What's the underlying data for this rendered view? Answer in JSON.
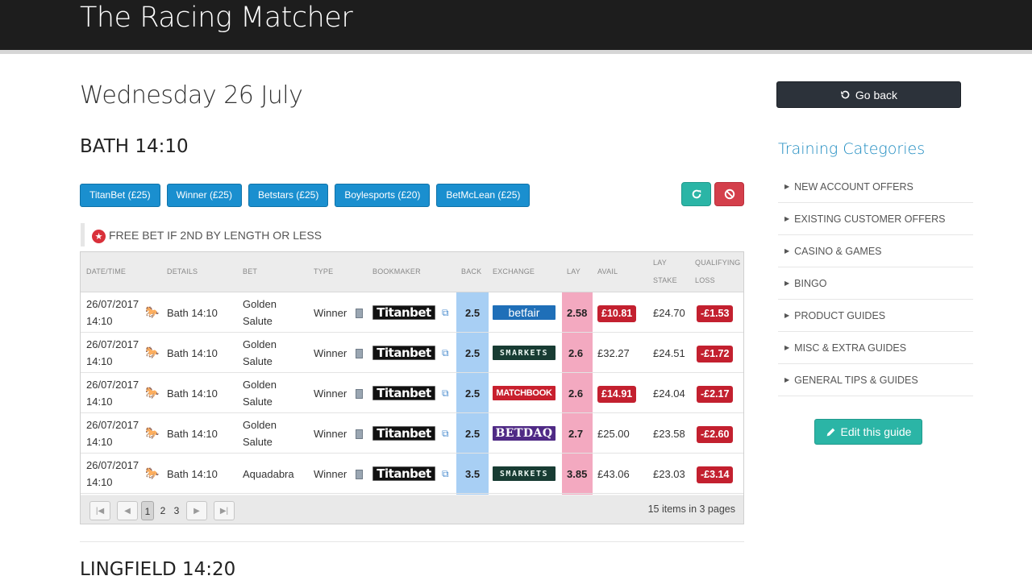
{
  "app": {
    "brand": "The Racing Matcher"
  },
  "page": {
    "date_title": "Wednesday 26 July",
    "race_title": "BATH 14:10",
    "next_race_title": "LINGFIELD 14:20"
  },
  "bookmaker_buttons": [
    "TitanBet (£25)",
    "Winner (£25)",
    "Betstars (£25)",
    "Boylesports (£20)",
    "BetMcLean (£25)"
  ],
  "action_icons": {
    "refresh": "refresh-icon",
    "cancel": "ban-icon"
  },
  "promo": {
    "icon": "star-icon",
    "text": "FREE BET IF 2ND BY LENGTH OR LESS"
  },
  "table": {
    "headers": {
      "datetime": "DATE/TIME",
      "details": "DETAILS",
      "bet": "BET",
      "type": "TYPE",
      "bookmaker": "BOOKMAKER",
      "back": "BACK",
      "exchange": "EXCHANGE",
      "lay": "LAY",
      "avail": "AVAIL",
      "lay_stake_1": "LAY",
      "lay_stake_2": "STAKE",
      "qualifying_1": "QUALIFYING",
      "qualifying_2": "LOSS"
    },
    "rows": [
      {
        "date": "26/07/2017",
        "time": "14:10",
        "details": "Bath 14:10",
        "bet_1": "Golden",
        "bet_2": "Salute",
        "type": "Winner",
        "bookmaker": "Titanbet",
        "back": "2.5",
        "exchange": "betfair",
        "lay": "2.58",
        "avail": "£10.81",
        "lay_stake": "£24.70",
        "qualifying_loss": "-£1.53"
      },
      {
        "date": "26/07/2017",
        "time": "14:10",
        "details": "Bath 14:10",
        "bet_1": "Golden",
        "bet_2": "Salute",
        "type": "Winner",
        "bookmaker": "Titanbet",
        "back": "2.5",
        "exchange": "SMARKETS",
        "lay": "2.6",
        "avail": "£32.27",
        "lay_stake": "£24.51",
        "qualifying_loss": "-£1.72"
      },
      {
        "date": "26/07/2017",
        "time": "14:10",
        "details": "Bath 14:10",
        "bet_1": "Golden",
        "bet_2": "Salute",
        "type": "Winner",
        "bookmaker": "Titanbet",
        "back": "2.5",
        "exchange": "MATCHBOOK",
        "lay": "2.6",
        "avail": "£14.91",
        "lay_stake": "£24.04",
        "qualifying_loss": "-£2.17"
      },
      {
        "date": "26/07/2017",
        "time": "14:10",
        "details": "Bath 14:10",
        "bet_1": "Golden",
        "bet_2": "Salute",
        "type": "Winner",
        "bookmaker": "Titanbet",
        "back": "2.5",
        "exchange": "BETDAQ",
        "lay": "2.7",
        "avail": "£25.00",
        "lay_stake": "£23.58",
        "qualifying_loss": "-£2.60"
      },
      {
        "date": "26/07/2017",
        "time": "14:10",
        "details": "Bath 14:10",
        "bet_1": "Aquadabra",
        "bet_2": "",
        "type": "Winner",
        "bookmaker": "Titanbet",
        "back": "3.5",
        "exchange": "SMARKETS",
        "lay": "3.85",
        "avail": "£43.06",
        "lay_stake": "£23.03",
        "qualifying_loss": "-£3.14"
      }
    ],
    "pager": {
      "pages": [
        "1",
        "2",
        "3"
      ],
      "current": "1",
      "info": "15 items in 3 pages"
    }
  },
  "sidebar": {
    "go_back": "Go back",
    "categories_title": "Training Categories",
    "categories": [
      "NEW ACCOUNT OFFERS",
      "EXISTING CUSTOMER OFFERS",
      "CASINO & GAMES",
      "BINGO",
      "PRODUCT GUIDES",
      "MISC & EXTRA GUIDES",
      "GENERAL TIPS & GUIDES"
    ],
    "edit_guide": "Edit this guide"
  },
  "colors": {
    "back": "#a8cff4",
    "lay": "#f3a9c0",
    "accent": "#1a8fcf",
    "teal": "#2bb5a6",
    "danger": "#c3202f"
  }
}
